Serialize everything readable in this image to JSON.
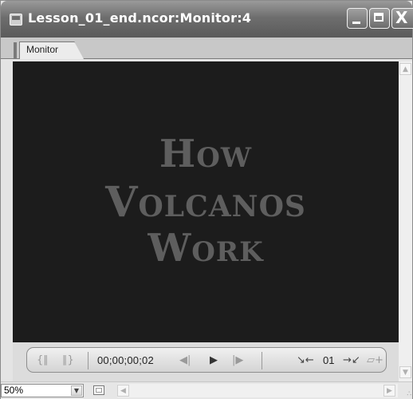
{
  "window": {
    "title": "Lesson_01_end.ncor:Monitor:4",
    "close_glyph": "X"
  },
  "tabs": [
    {
      "label": "Monitor",
      "active": true
    }
  ],
  "monitor": {
    "title_lines": [
      "How",
      "Volcanos",
      "Work"
    ],
    "background": "#1c1c1c",
    "text_color": "#5e5e5e"
  },
  "controls": {
    "timecode": "00;00;00;02",
    "clip_number": "01",
    "icons": [
      "mark-in-icon",
      "mark-out-icon",
      "step-back-icon",
      "play-icon",
      "step-forward-icon",
      "go-to-in-icon",
      "go-to-out-icon",
      "add-marker-icon"
    ]
  },
  "bottombar": {
    "zoom_value": "50%"
  }
}
